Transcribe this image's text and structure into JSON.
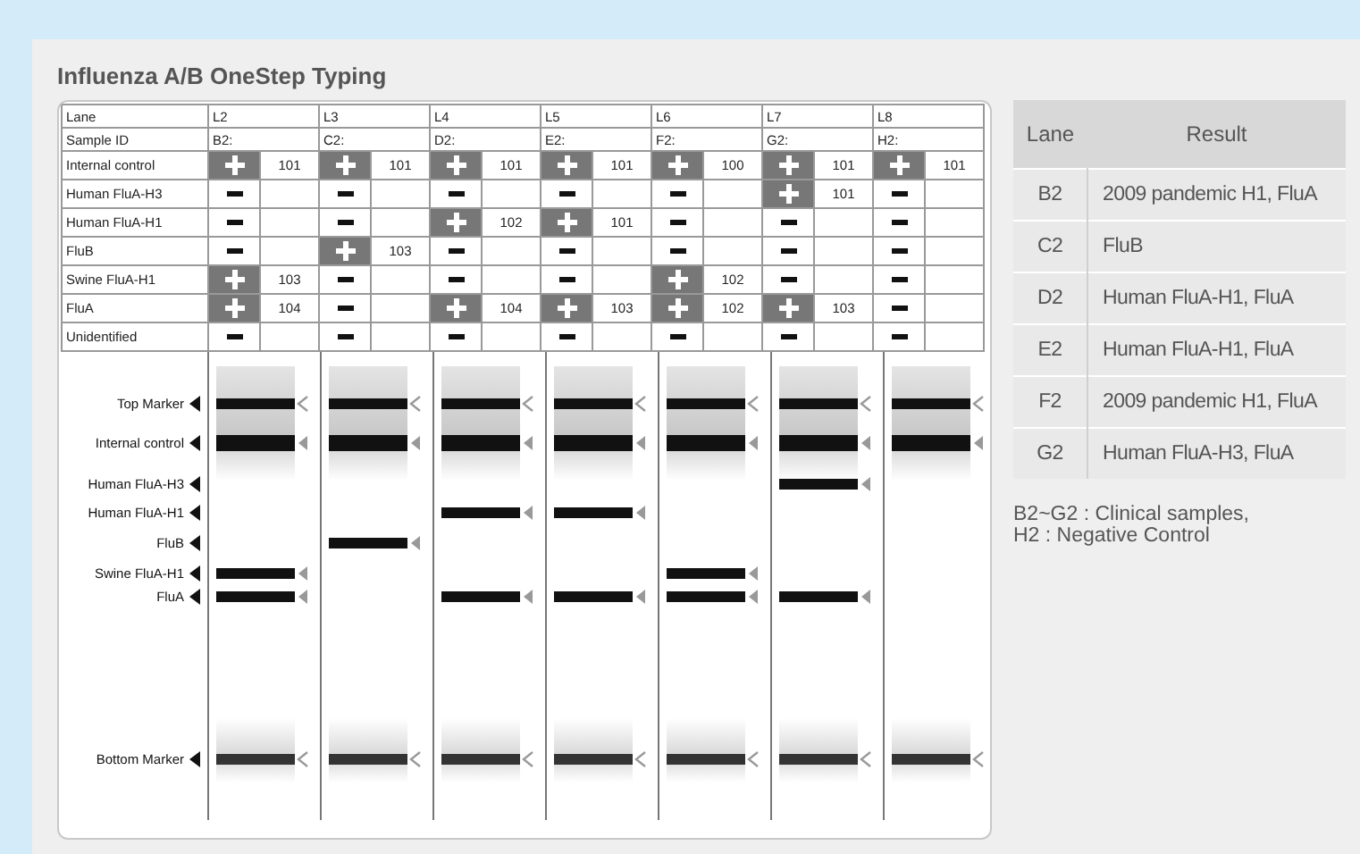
{
  "title": "Influenza A/B OneStep Typing",
  "typing_table": {
    "header_labels": [
      "Lane",
      "Sample ID"
    ],
    "targets": [
      "Internal control",
      "Human FluA-H3",
      "Human FluA-H1",
      "FluB",
      "Swine FluA-H1",
      "FluA",
      "Unidentified"
    ],
    "lanes": [
      {
        "lane": "L2",
        "sample_id": "B2:",
        "results": [
          {
            "positive": true,
            "value": "101"
          },
          {
            "positive": false
          },
          {
            "positive": false
          },
          {
            "positive": false
          },
          {
            "positive": true,
            "value": "103"
          },
          {
            "positive": true,
            "value": "104"
          },
          {
            "positive": false
          }
        ]
      },
      {
        "lane": "L3",
        "sample_id": "C2:",
        "results": [
          {
            "positive": true,
            "value": "101"
          },
          {
            "positive": false
          },
          {
            "positive": false
          },
          {
            "positive": true,
            "value": "103"
          },
          {
            "positive": false
          },
          {
            "positive": false
          },
          {
            "positive": false
          }
        ]
      },
      {
        "lane": "L4",
        "sample_id": "D2:",
        "results": [
          {
            "positive": true,
            "value": "101"
          },
          {
            "positive": false
          },
          {
            "positive": true,
            "value": "102"
          },
          {
            "positive": false
          },
          {
            "positive": false
          },
          {
            "positive": true,
            "value": "104"
          },
          {
            "positive": false
          }
        ]
      },
      {
        "lane": "L5",
        "sample_id": "E2:",
        "results": [
          {
            "positive": true,
            "value": "101"
          },
          {
            "positive": false
          },
          {
            "positive": true,
            "value": "101"
          },
          {
            "positive": false
          },
          {
            "positive": false
          },
          {
            "positive": true,
            "value": "103"
          },
          {
            "positive": false
          }
        ]
      },
      {
        "lane": "L6",
        "sample_id": "F2:",
        "results": [
          {
            "positive": true,
            "value": "100"
          },
          {
            "positive": false
          },
          {
            "positive": false
          },
          {
            "positive": false
          },
          {
            "positive": true,
            "value": "102"
          },
          {
            "positive": true,
            "value": "102"
          },
          {
            "positive": false
          }
        ]
      },
      {
        "lane": "L7",
        "sample_id": "G2:",
        "results": [
          {
            "positive": true,
            "value": "101"
          },
          {
            "positive": true,
            "value": "101"
          },
          {
            "positive": false
          },
          {
            "positive": false
          },
          {
            "positive": false
          },
          {
            "positive": true,
            "value": "103"
          },
          {
            "positive": false
          }
        ]
      },
      {
        "lane": "L8",
        "sample_id": "H2:",
        "results": [
          {
            "positive": true,
            "value": "101"
          },
          {
            "positive": false
          },
          {
            "positive": false
          },
          {
            "positive": false
          },
          {
            "positive": false
          },
          {
            "positive": false
          },
          {
            "positive": false
          }
        ]
      }
    ]
  },
  "gel": {
    "markers": [
      {
        "label": "Top Marker",
        "kind": "marker"
      },
      {
        "label": "Internal control",
        "kind": "target"
      },
      {
        "label": "Human FluA-H3",
        "kind": "target"
      },
      {
        "label": "Human FluA-H1",
        "kind": "target"
      },
      {
        "label": "FluB",
        "kind": "target"
      },
      {
        "label": "Swine FluA-H1",
        "kind": "target"
      },
      {
        "label": "FluA",
        "kind": "target"
      },
      {
        "label": "Bottom Marker",
        "kind": "marker"
      }
    ],
    "lanes": [
      {
        "bands": [
          true,
          true,
          false,
          false,
          false,
          true,
          true,
          true
        ]
      },
      {
        "bands": [
          true,
          true,
          false,
          false,
          true,
          false,
          false,
          true
        ]
      },
      {
        "bands": [
          true,
          true,
          false,
          true,
          false,
          false,
          true,
          true
        ]
      },
      {
        "bands": [
          true,
          true,
          false,
          true,
          false,
          false,
          true,
          true
        ]
      },
      {
        "bands": [
          true,
          true,
          false,
          false,
          false,
          true,
          true,
          true
        ]
      },
      {
        "bands": [
          true,
          true,
          true,
          false,
          false,
          false,
          true,
          true
        ]
      },
      {
        "bands": [
          true,
          true,
          false,
          false,
          false,
          false,
          false,
          true
        ]
      }
    ]
  },
  "result_table": {
    "columns": [
      "Lane",
      "Result"
    ],
    "rows": [
      {
        "lane": "B2",
        "result": "2009 pandemic H1, FluA"
      },
      {
        "lane": "C2",
        "result": "FluB"
      },
      {
        "lane": "D2",
        "result": "Human FluA-H1, FluA"
      },
      {
        "lane": "E2",
        "result": "Human FluA-H1, FluA"
      },
      {
        "lane": "F2",
        "result": "2009 pandemic H1, FluA"
      },
      {
        "lane": "G2",
        "result": "Human FluA-H3, FluA"
      }
    ]
  },
  "footnote": "B2~G2 : Clinical samples, H2 : Negative Control"
}
